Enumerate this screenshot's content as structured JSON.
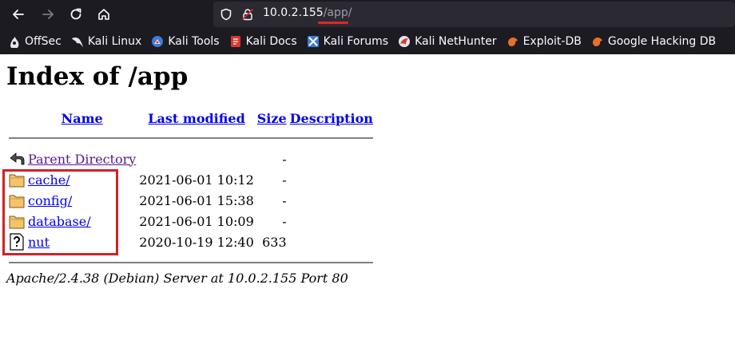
{
  "browser": {
    "url_host": "10.0.2.155",
    "url_path": "/app/",
    "bookmarks": [
      {
        "label": "OffSec",
        "icon": "offsec-icon"
      },
      {
        "label": "Kali Linux",
        "icon": "kali-dragon-icon"
      },
      {
        "label": "Kali Tools",
        "icon": "kali-tools-icon"
      },
      {
        "label": "Kali Docs",
        "icon": "kali-docs-icon"
      },
      {
        "label": "Kali Forums",
        "icon": "kali-forums-icon"
      },
      {
        "label": "Kali NetHunter",
        "icon": "nethunter-icon"
      },
      {
        "label": "Exploit-DB",
        "icon": "exploit-db-icon"
      },
      {
        "label": "Google Hacking DB",
        "icon": "ghdb-icon"
      }
    ]
  },
  "page": {
    "title": "Index of /app",
    "headers": {
      "name": "Name",
      "last_modified": "Last modified",
      "size": "Size",
      "description": "Description"
    },
    "parent": {
      "name": "Parent Directory",
      "size": "-"
    },
    "rows": [
      {
        "name": "cache/",
        "modified": "2021-06-01 10:12",
        "size": "-",
        "icon": "folder-icon"
      },
      {
        "name": "config/",
        "modified": "2021-06-01 15:38",
        "size": "-",
        "icon": "folder-icon"
      },
      {
        "name": "database/",
        "modified": "2021-06-01 10:09",
        "size": "-",
        "icon": "folder-icon"
      },
      {
        "name": "nut",
        "modified": "2020-10-19 12:40",
        "size": "633",
        "icon": "unknown-file-icon"
      }
    ],
    "footer": "Apache/2.4.38 (Debian) Server at 10.0.2.155 Port 80"
  },
  "colors": {
    "chrome_bg": "#1c1b22",
    "urlbar_bg": "#2b2a33",
    "link": "#0000ee",
    "visited_link": "#551a8b",
    "annotation_red": "#d42025"
  }
}
